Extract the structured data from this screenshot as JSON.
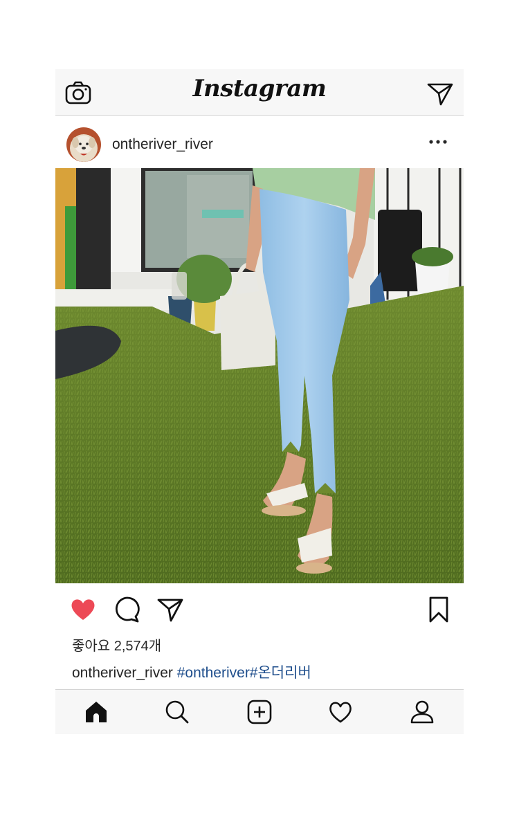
{
  "app": {
    "title": "Instagram"
  },
  "post": {
    "username": "ontheriver_river",
    "likes_text": "좋아요 2,574개",
    "caption_user": "ontheriver_river",
    "caption_tags": "#ontheriver#온더리버"
  },
  "icons": {
    "camera": "camera-icon",
    "direct": "paper-plane-icon",
    "more": "more-dots-icon",
    "like": "heart-filled-icon",
    "comment": "comment-bubble-icon",
    "share": "paper-plane-icon",
    "save": "bookmark-icon",
    "nav": [
      "home-icon",
      "search-icon",
      "add-post-icon",
      "activity-heart-icon",
      "profile-icon"
    ]
  },
  "colors": {
    "like_red": "#ed4956",
    "hashtag": "#1f4e8c",
    "bar_bg": "#f7f7f7"
  }
}
